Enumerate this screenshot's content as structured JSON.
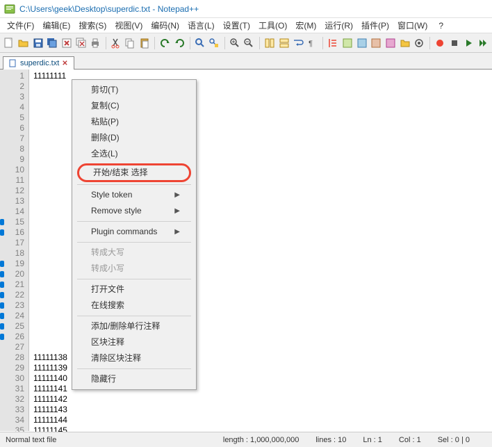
{
  "titlebar": {
    "title": "C:\\Users\\geek\\Desktop\\superdic.txt - Notepad++"
  },
  "menubar": {
    "items": [
      {
        "label": "文件(F)"
      },
      {
        "label": "编辑(E)"
      },
      {
        "label": "搜索(S)"
      },
      {
        "label": "视图(V)"
      },
      {
        "label": "编码(N)"
      },
      {
        "label": "语言(L)"
      },
      {
        "label": "设置(T)"
      },
      {
        "label": "工具(O)"
      },
      {
        "label": "宏(M)"
      },
      {
        "label": "运行(R)"
      },
      {
        "label": "插件(P)"
      },
      {
        "label": "窗口(W)"
      }
    ],
    "help": "?"
  },
  "tab": {
    "label": "superdic.txt"
  },
  "editor": {
    "lines_visible": [
      {
        "num": "1",
        "text": "11111111"
      },
      {
        "num": "2",
        "text": ""
      },
      {
        "num": "3",
        "text": ""
      },
      {
        "num": "4",
        "text": ""
      },
      {
        "num": "5",
        "text": ""
      },
      {
        "num": "6",
        "text": ""
      },
      {
        "num": "7",
        "text": ""
      },
      {
        "num": "8",
        "text": ""
      },
      {
        "num": "9",
        "text": ""
      },
      {
        "num": "10",
        "text": ""
      },
      {
        "num": "11",
        "text": ""
      },
      {
        "num": "12",
        "text": ""
      },
      {
        "num": "13",
        "text": ""
      },
      {
        "num": "14",
        "text": ""
      },
      {
        "num": "15",
        "text": ""
      },
      {
        "num": "16",
        "text": ""
      },
      {
        "num": "17",
        "text": ""
      },
      {
        "num": "18",
        "text": ""
      },
      {
        "num": "19",
        "text": ""
      },
      {
        "num": "20",
        "text": ""
      },
      {
        "num": "21",
        "text": ""
      },
      {
        "num": "22",
        "text": ""
      },
      {
        "num": "23",
        "text": ""
      },
      {
        "num": "24",
        "text": ""
      },
      {
        "num": "25",
        "text": ""
      },
      {
        "num": "26",
        "text": ""
      },
      {
        "num": "27",
        "text": ""
      },
      {
        "num": "28",
        "text": "11111138"
      },
      {
        "num": "29",
        "text": "11111139"
      },
      {
        "num": "30",
        "text": "11111140"
      },
      {
        "num": "31",
        "text": "11111141"
      },
      {
        "num": "32",
        "text": "11111142"
      },
      {
        "num": "33",
        "text": "11111143"
      },
      {
        "num": "34",
        "text": "11111144"
      },
      {
        "num": "35",
        "text": "11111145"
      }
    ]
  },
  "context_menu": {
    "items": [
      {
        "label": "剪切(T)"
      },
      {
        "label": "复制(C)"
      },
      {
        "label": "粘贴(P)"
      },
      {
        "label": "删除(D)"
      },
      {
        "label": "全选(L)"
      },
      {
        "label": "开始/结束 选择",
        "highlighted": true
      },
      {
        "sep": true
      },
      {
        "label": "Style token",
        "submenu": true
      },
      {
        "label": "Remove style",
        "submenu": true
      },
      {
        "sep": true
      },
      {
        "label": "Plugin commands",
        "submenu": true
      },
      {
        "sep": true
      },
      {
        "label": "转成大写",
        "disabled": true
      },
      {
        "label": "转成小写",
        "disabled": true
      },
      {
        "sep": true
      },
      {
        "label": "打开文件"
      },
      {
        "label": "在线搜索"
      },
      {
        "sep": true
      },
      {
        "label": "添加/删除单行注释"
      },
      {
        "label": "区块注释"
      },
      {
        "label": "清除区块注释"
      },
      {
        "sep": true
      },
      {
        "label": "隐藏行"
      }
    ]
  },
  "statusbar": {
    "filetype": "Normal text file",
    "length": "length : 1,000,000,000",
    "lines": "lines : 10",
    "ln": "Ln : 1",
    "col": "Col : 1",
    "sel": "Sel : 0 | 0"
  },
  "icons": {
    "new": "new-file-icon",
    "open": "open-file-icon",
    "save": "save-icon",
    "saveall": "save-all-icon",
    "close": "close-icon",
    "closeall": "close-all-icon",
    "print": "print-icon",
    "cut": "cut-icon",
    "copy": "copy-icon",
    "paste": "paste-icon",
    "undo": "undo-icon",
    "redo": "redo-icon",
    "find": "find-icon",
    "replace": "replace-icon",
    "zoomin": "zoom-in-icon",
    "zoomout": "zoom-out-icon",
    "sync": "sync-icon",
    "wrap": "wrap-icon",
    "allchars": "all-chars-icon",
    "indent": "indent-icon",
    "foldall": "fold-all-icon",
    "unfoldall": "unfold-all-icon",
    "doclist": "doc-list-icon",
    "docmap": "doc-map-icon",
    "funclist": "func-list-icon",
    "monitor": "monitor-icon",
    "record": "record-icon",
    "stop": "stop-icon",
    "play": "play-icon",
    "playmulti": "play-multi-icon"
  }
}
